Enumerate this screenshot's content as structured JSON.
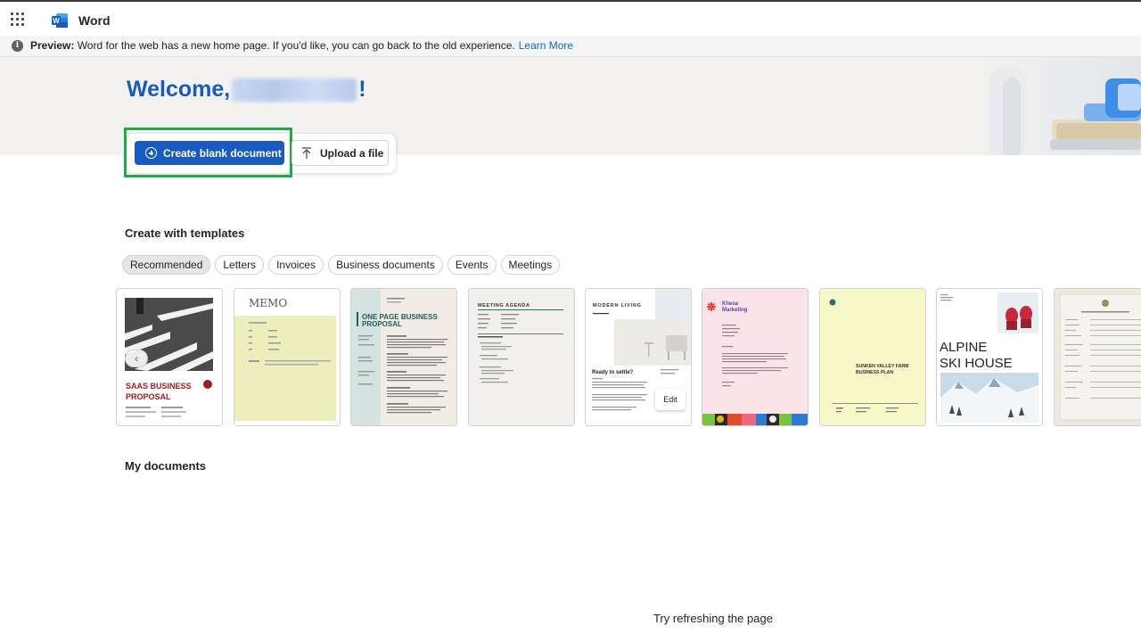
{
  "app": {
    "title": "Word"
  },
  "preview_bar": {
    "label": "Preview:",
    "text": " Word for the web has a new home page. If you'd like, you can go back to the old experience.",
    "link": "Learn More"
  },
  "welcome": {
    "prefix": "Welcome, ",
    "suffix": "!"
  },
  "actions": {
    "create_blank": "Create blank document",
    "upload": "Upload a file"
  },
  "templates": {
    "heading": "Create with templates",
    "filters": [
      "Recommended",
      "Letters",
      "Invoices",
      "Business documents",
      "Events",
      "Meetings"
    ],
    "active_filter": "Recommended",
    "cards": [
      {
        "title_line1": "SAAS BUSINESS",
        "title_line2": "PROPOSAL"
      },
      {
        "title": "MEMO"
      },
      {
        "title_line1": "ONE PAGE BUSINESS",
        "title_line2": "PROPOSAL"
      },
      {
        "title": "MEETING AGENDA"
      },
      {
        "title": "MODERN LIVING",
        "subtitle": "Ready to settle?",
        "edit_label": "Edit"
      },
      {
        "title_line1": "Khesa",
        "title_line2": "Marketing"
      },
      {
        "title_line1": "SUNKEN VALLEY FARM",
        "title_line2": "BUSINESS PLAN"
      },
      {
        "title_line1": "ALPINE",
        "title_line2": "SKI HOUSE"
      },
      {
        "title": ""
      }
    ]
  },
  "my_documents": {
    "heading": "My documents",
    "empty_message": "Try refreshing the page"
  },
  "colors": {
    "brand": "#185abd",
    "highlight": "#1faa4a",
    "link": "#0f6cbd"
  }
}
